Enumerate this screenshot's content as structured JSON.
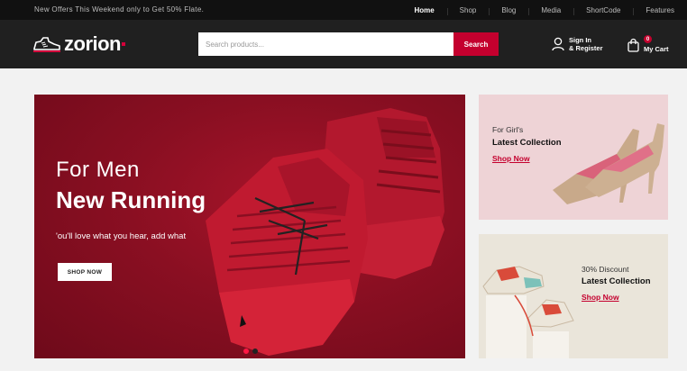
{
  "topbar": {
    "promo": "New Offers This Weekend only to Get 50% Flate.",
    "nav": [
      "Home",
      "Shop",
      "Blog",
      "Media",
      "ShortCode",
      "Features"
    ]
  },
  "header": {
    "logo_text": "zorion",
    "search_placeholder": "Search products...",
    "search_button": "Search",
    "account_line1": "Sign In",
    "account_line2": "& Register",
    "cart_count": "0",
    "cart_label": "My Cart"
  },
  "hero": {
    "subtitle": "For Men",
    "title": "New Running",
    "text": "'ou'll love what you hear, add what",
    "button": "SHOP NOW",
    "slide_active": 1,
    "slide_count": 2
  },
  "banner1": {
    "category": "For Girl's",
    "title": "Latest Collection",
    "link": "Shop Now"
  },
  "banner2": {
    "category": "30% Discount",
    "title": "Latest Collection",
    "link": "Shop Now"
  },
  "colors": {
    "accent": "#c4002e",
    "hero_bg": "#8a0f22",
    "banner1_bg": "#eed3d6",
    "banner2_bg": "#eae5da"
  }
}
